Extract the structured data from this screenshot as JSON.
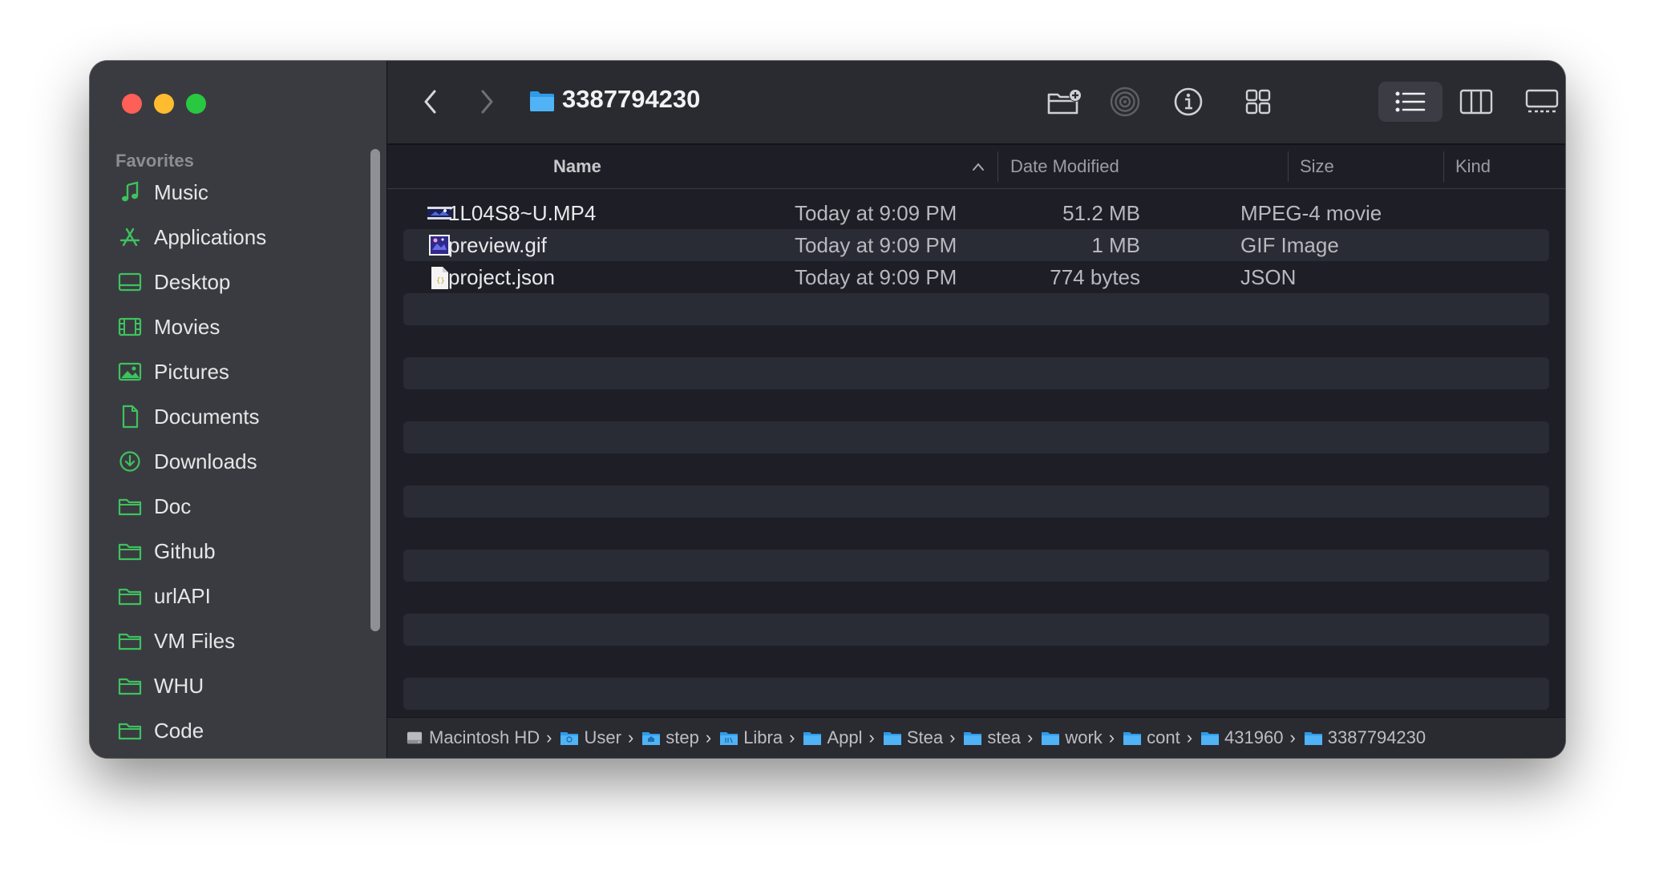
{
  "window": {
    "title": "3387794230"
  },
  "sidebar": {
    "section_title": "Favorites",
    "items": [
      {
        "label": "Music",
        "icon": "music-note-icon"
      },
      {
        "label": "Applications",
        "icon": "applications-icon"
      },
      {
        "label": "Desktop",
        "icon": "desktop-icon"
      },
      {
        "label": "Movies",
        "icon": "film-icon"
      },
      {
        "label": "Pictures",
        "icon": "photo-icon"
      },
      {
        "label": "Documents",
        "icon": "document-icon"
      },
      {
        "label": "Downloads",
        "icon": "download-icon"
      },
      {
        "label": "Doc",
        "icon": "folder-icon"
      },
      {
        "label": "Github",
        "icon": "folder-icon"
      },
      {
        "label": "urlAPI",
        "icon": "folder-icon"
      },
      {
        "label": "VM Files",
        "icon": "folder-icon"
      },
      {
        "label": "WHU",
        "icon": "folder-icon"
      },
      {
        "label": "Code",
        "icon": "folder-icon"
      }
    ],
    "accent_color": "#3ec25e"
  },
  "columns": {
    "name": "Name",
    "date_modified": "Date Modified",
    "size": "Size",
    "kind": "Kind"
  },
  "files": [
    {
      "name": "1L04S8~U.MP4",
      "date": "Today at 9:09 PM",
      "size": "51.2 MB",
      "kind": "MPEG-4 movie",
      "icon": "video-thumbnail-icon"
    },
    {
      "name": "preview.gif",
      "date": "Today at 9:09 PM",
      "size": "1 MB",
      "kind": "GIF Image",
      "icon": "image-thumbnail-icon"
    },
    {
      "name": "project.json",
      "date": "Today at 9:09 PM",
      "size": "774 bytes",
      "kind": "JSON",
      "icon": "json-file-icon"
    }
  ],
  "pathbar": {
    "items": [
      "Macintosh HD",
      "User",
      "step",
      "Libra",
      "Appl",
      "Stea",
      "stea",
      "work",
      "cont",
      "431960",
      "3387794230"
    ]
  }
}
